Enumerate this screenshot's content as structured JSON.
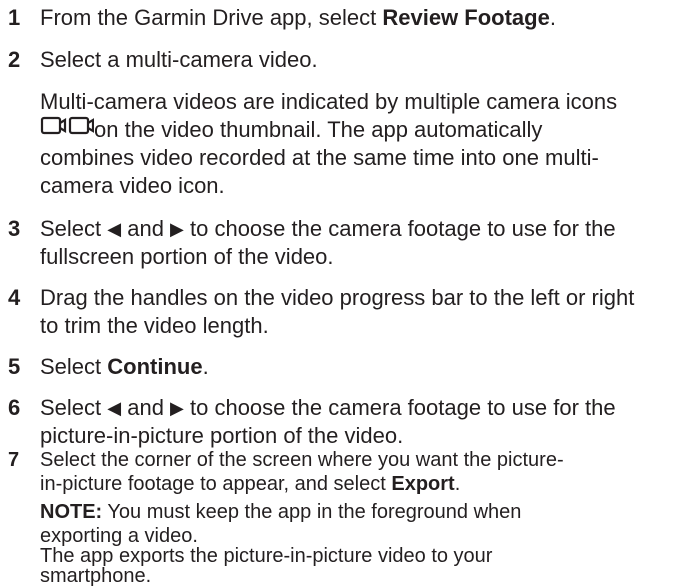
{
  "steps": [
    {
      "num": "1",
      "lines": [
        {
          "pre": "From the Garmin Drive app, select ",
          "bold": "Review Footage",
          "post": "."
        }
      ]
    },
    {
      "num": "2",
      "text": "Select a multi-camera video.",
      "desc1": "Multi-camera videos are indicated by multiple camera icons",
      "desc2": "on the video thumbnail. The app automatically",
      "desc3": "combines video recorded at the same time into one multi-",
      "desc4": "camera video icon.",
      "icon": "multi-camera-icon"
    },
    {
      "num": "3",
      "pre": "Select ",
      "mid": " and ",
      "post": " to choose the camera footage to use for the",
      "line2": "fullscreen portion of the video."
    },
    {
      "num": "4",
      "line1": "Drag the handles on the video progress bar to the left or right",
      "line2": "to trim the video length."
    },
    {
      "num": "5",
      "pre": "Select ",
      "bold": "Continue",
      "post": "."
    },
    {
      "num": "6",
      "pre": "Select ",
      "mid": " and ",
      "post": " to choose the camera footage to use for the",
      "line2": "picture-in-picture portion of the video."
    },
    {
      "num": "7",
      "line1": "Select the corner of the screen where you want the picture-",
      "line2pre": "in-picture footage to appear, and select ",
      "line2bold": "Export",
      "line2post": ".",
      "note_label": "NOTE:",
      "note1": " You must keep the app in the foreground when",
      "note2": "exporting a video.",
      "result1": "The app exports the picture-in-picture video to your",
      "result2": "smartphone."
    }
  ],
  "icons": {
    "left": "◀",
    "right": "▶"
  }
}
